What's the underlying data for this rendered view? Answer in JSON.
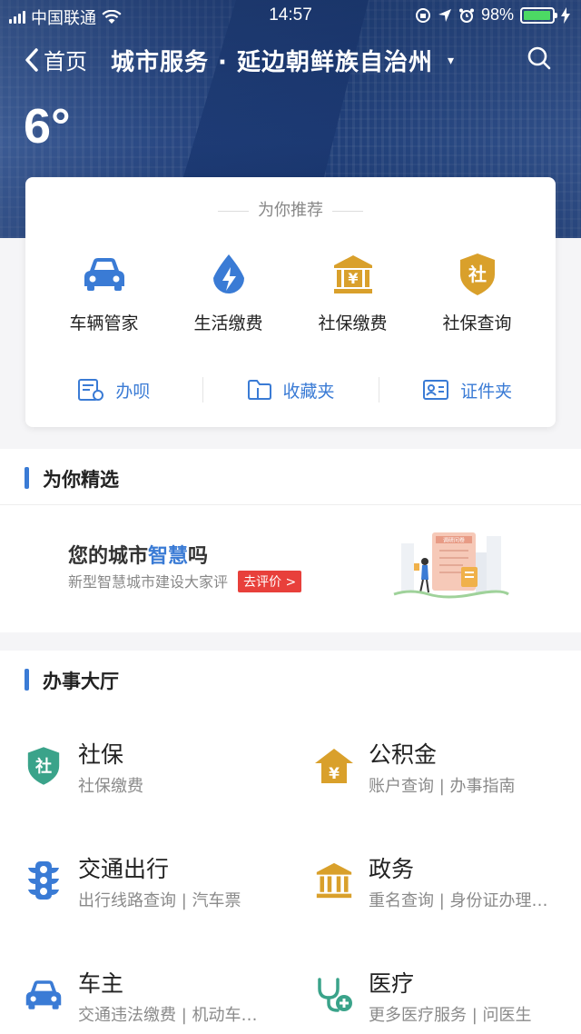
{
  "status_bar": {
    "carrier": "中国联通",
    "time": "14:57",
    "battery_percent": "98%",
    "battery_level": 0.98
  },
  "nav": {
    "back_label": "首页",
    "title": "城市服务 · 延边朝鲜族自治州",
    "dropdown_caret": "▾"
  },
  "weather": {
    "temperature": "6°"
  },
  "recommend": {
    "header": "为你推荐",
    "items": [
      {
        "label": "车辆管家",
        "icon": "car-icon",
        "color": "#3a7bd5"
      },
      {
        "label": "生活缴费",
        "icon": "lightning-drop-icon",
        "color": "#3a7bd5"
      },
      {
        "label": "社保缴费",
        "icon": "bank-yuan-icon",
        "color": "#d9a02b"
      },
      {
        "label": "社保查询",
        "icon": "shield-she-icon",
        "color": "#d9a02b"
      }
    ],
    "shortcuts": [
      {
        "label": "办呗",
        "icon": "document-icon"
      },
      {
        "label": "收藏夹",
        "icon": "folder-icon"
      },
      {
        "label": "证件夹",
        "icon": "id-card-icon"
      }
    ]
  },
  "featured": {
    "header": "为你精选",
    "banner_title_prefix": "您的城市",
    "banner_title_highlight": "智慧",
    "banner_title_suffix": "吗",
    "banner_subtitle": "新型智慧城市建设大家评",
    "banner_button": "去评价 >",
    "illustration_label": "调研问卷"
  },
  "hall": {
    "header": "办事大厅",
    "services": [
      {
        "name": "社保",
        "sub": "社保缴费",
        "icon": "shield-she-icon",
        "color": "#3aa38a"
      },
      {
        "name": "公积金",
        "sub": "账户查询 | 办事指南",
        "icon": "house-yuan-icon",
        "color": "#d9a02b"
      },
      {
        "name": "交通出行",
        "sub": "出行线路查询 | 汽车票",
        "icon": "traffic-light-icon",
        "color": "#3a7bd5"
      },
      {
        "name": "政务",
        "sub": "重名查询 | 身份证办理…",
        "icon": "government-building-icon",
        "color": "#d9a02b"
      },
      {
        "name": "车主",
        "sub": "交通违法缴费 | 机动车…",
        "icon": "car-icon",
        "color": "#3a7bd5"
      },
      {
        "name": "医疗",
        "sub": "更多医疗服务 | 问医生",
        "icon": "stethoscope-icon",
        "color": "#3aa38a"
      }
    ]
  },
  "she_glyph": "社",
  "yuan_glyph": "¥"
}
